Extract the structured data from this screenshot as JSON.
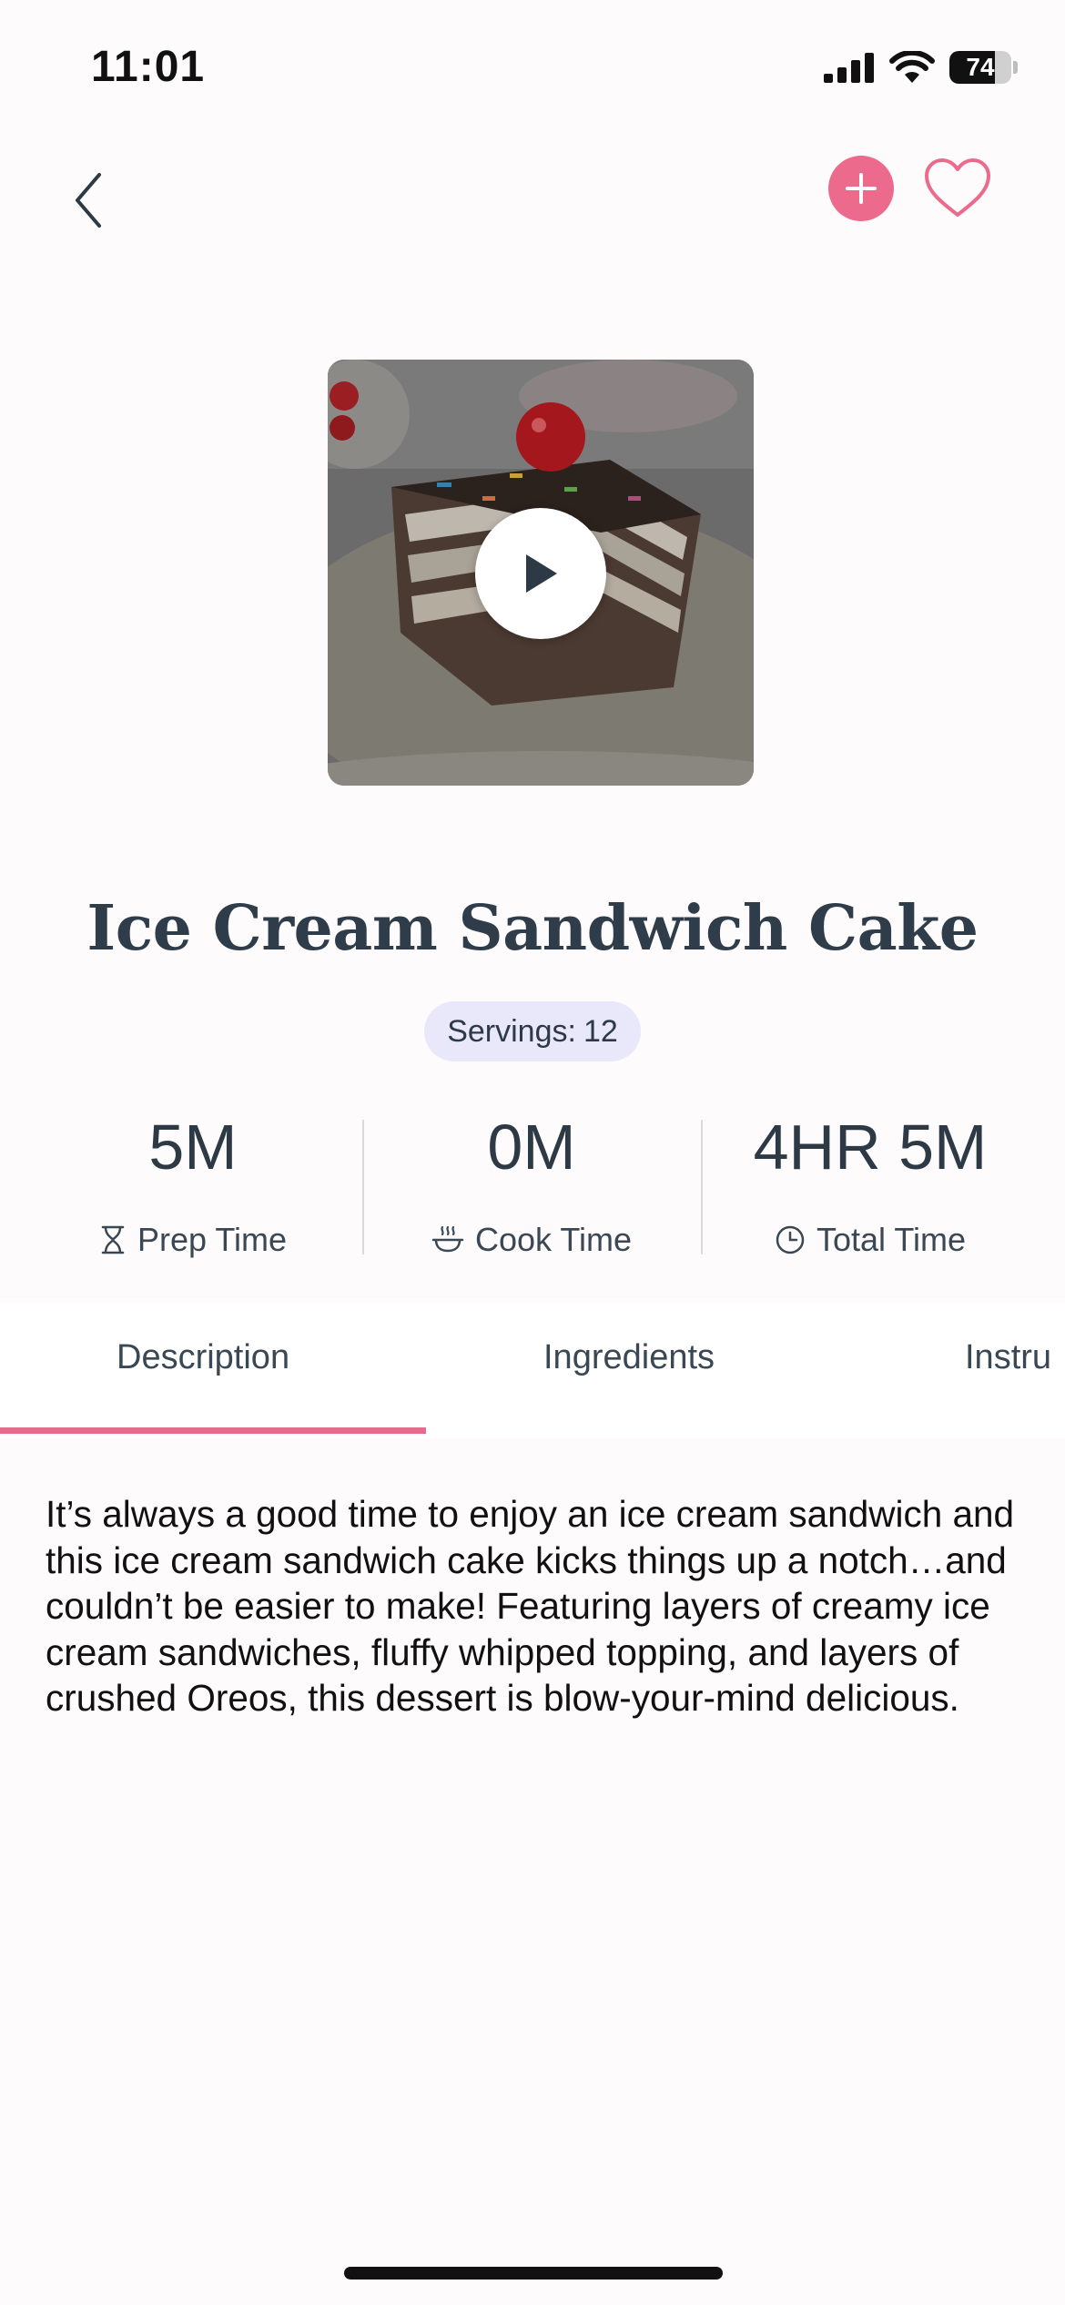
{
  "status_bar": {
    "time": "11:01",
    "battery_level": "74",
    "icons": [
      "signal-icon",
      "wifi-icon",
      "battery-icon"
    ]
  },
  "nav": {
    "icons": [
      "back-chevron-icon",
      "plus-icon",
      "heart-outline-icon"
    ],
    "accent_color": "#ec6b8d"
  },
  "hero": {
    "media": "video-thumbnail",
    "overlay_icon": "play-icon"
  },
  "recipe": {
    "title": "Ice Cream Sandwich Cake",
    "servings_label": "Servings:",
    "servings_value": "12"
  },
  "stats": [
    {
      "value": "5M",
      "label": "Prep Time",
      "icon": "hourglass-icon"
    },
    {
      "value": "0M",
      "label": "Cook Time",
      "icon": "pot-icon"
    },
    {
      "value": "4HR 5M",
      "label": "Total Time",
      "icon": "clock-icon"
    }
  ],
  "tabs": [
    {
      "label": "Description",
      "active": true
    },
    {
      "label": "Ingredients",
      "active": false
    },
    {
      "label": "Instru",
      "active": false
    }
  ],
  "description_text": "It’s always a good time to enjoy an ice cream sandwich and this ice cream sandwich cake kicks things up a notch…and couldn’t be easier to make! Featuring layers of creamy ice cream sandwiches, fluffy whipped topping, and layers of crushed Oreos, this dessert is blow-your-mind delicious.",
  "colors": {
    "accent_pink": "#e66b8c",
    "servings_badge_bg": "#e9e8fb",
    "text_dark": "#2d3a46"
  }
}
